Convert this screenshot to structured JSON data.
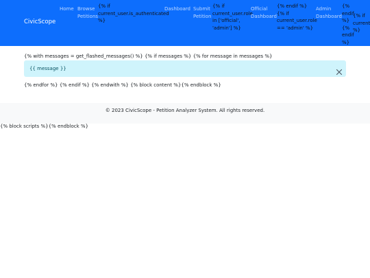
{
  "navbar": {
    "brand": "CivicScope",
    "items": [
      {
        "label": "Home"
      },
      {
        "label": "Browse Petitions"
      },
      {
        "label": "{% if current_user.is_authenticated %}"
      },
      {
        "label": "Dashboard"
      },
      {
        "label": "Submit Petition"
      },
      {
        "label": "{% if current_user.role in ['official', 'admin'] %}"
      },
      {
        "label": "Official Dashboard"
      },
      {
        "label": "{% endif %} {% if current_user.role == 'admin' %}"
      },
      {
        "label": "Admin Dashboard"
      },
      {
        "label": "{% endif %} {% endif %}"
      },
      {
        "label": "{% if current_user %}"
      }
    ],
    "colors": {
      "background": "#0d6efd",
      "link": "rgba(255,255,255,0.72)"
    }
  },
  "content": {
    "messages_line": "{% with messages = get_flashed_messages() %} {% if messages %} {% for message in messages %}",
    "alert_text": "{{ message }}",
    "end_line": "{% endfor %} {% endif %} {% endwith %} {% block content %}{% endblock %}"
  },
  "footer": {
    "text": "© 2023 CivicScope - Petition Analyzer System. All rights reserved."
  },
  "scripts_line": "{% block scripts %}{% endblock %}",
  "icons": {
    "alert_close": "close-icon"
  }
}
